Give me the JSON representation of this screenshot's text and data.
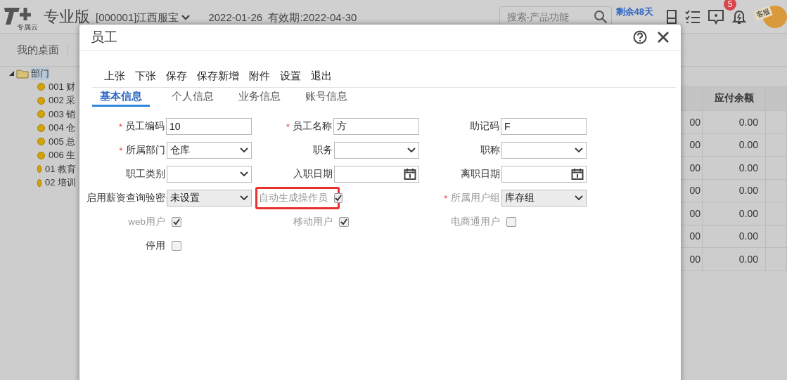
{
  "header": {
    "product": "专业版",
    "logo_sub": "专属云",
    "account": "[000001]江西服宝",
    "dates": "2022-01-26  有效期:2022-04-30",
    "search": {
      "placeholder": "搜索-产品功能"
    },
    "remaining": "剩余48天",
    "badge": "5",
    "support": "客服"
  },
  "nav": {
    "tabs": [
      {
        "label": "我的桌面",
        "selected": false
      }
    ]
  },
  "tree": {
    "label": "部门",
    "expanded": true,
    "selected": true,
    "children": [
      {
        "label": "001 财",
        "selected": false
      },
      {
        "label": "002 采",
        "selected": false
      },
      {
        "label": "003 销",
        "selected": false
      },
      {
        "label": "004 仓",
        "selected": false
      },
      {
        "label": "005 总",
        "selected": false
      },
      {
        "label": "006 生",
        "selected": false
      },
      {
        "label": "01 教育",
        "selected": false
      },
      {
        "label": "02 培训",
        "selected": false
      }
    ]
  },
  "table": {
    "columns": [
      "",
      "应付余额",
      ""
    ],
    "rows": [
      [
        "00",
        "0.00",
        ""
      ],
      [
        "00",
        "0.00",
        ""
      ],
      [
        "00",
        "0.00",
        ""
      ],
      [
        "00",
        "0.00",
        ""
      ],
      [
        "00",
        "0.00",
        ""
      ],
      [
        "00",
        "0.00",
        ""
      ],
      [
        "00",
        "0.00",
        ""
      ]
    ]
  },
  "dialog": {
    "title": "员工",
    "toolbar": [
      "上张",
      "下张",
      "保存",
      "保存新增",
      "附件",
      "设置",
      "退出"
    ],
    "tabs": [
      {
        "label": "基本信息",
        "selected": true
      },
      {
        "label": "个人信息",
        "selected": false
      },
      {
        "label": "业务信息",
        "selected": false
      },
      {
        "label": "账号信息",
        "selected": false
      }
    ],
    "rows": [
      [
        {
          "label": "员工编码",
          "kind": "text",
          "required_mark": "*",
          "value": "10"
        },
        {
          "label": "员工名称",
          "kind": "text",
          "required_mark": "*",
          "value": "方"
        },
        {
          "label": "助记码",
          "kind": "text",
          "value": "F"
        }
      ],
      [
        {
          "label": "所属部门",
          "kind": "select",
          "required_mark": "*",
          "value": "仓库"
        },
        {
          "label": "职务",
          "kind": "select"
        },
        {
          "label": "职称",
          "kind": "select"
        }
      ],
      [
        {
          "label": "职工类别",
          "kind": "select"
        },
        {
          "label": "入职日期",
          "kind": "date"
        },
        {
          "label": "离职日期",
          "kind": "date"
        }
      ],
      [
        {
          "label": "启用薪资查询验密",
          "kind": "select",
          "disabled": true,
          "value": "未设置"
        },
        {
          "label": "自动生成操作员",
          "kind": "checkbox",
          "label_dimmed": true,
          "checked": true,
          "highlighted": true
        },
        {
          "label": "所属用户组",
          "kind": "select",
          "required_mark": "*",
          "label_dimmed": true,
          "disabled": true,
          "value": "库存组"
        }
      ],
      [
        {
          "label": "web用户",
          "kind": "checkbox",
          "label_dimmed": true,
          "checked": true
        },
        {
          "label": "移动用户",
          "kind": "checkbox",
          "label_dimmed": true,
          "checked": true
        },
        {
          "label": "电商通用户",
          "kind": "checkbox",
          "label_dimmed": true,
          "checked": false
        }
      ],
      [
        {
          "label": "停用",
          "kind": "checkbox",
          "label_dimmed": false,
          "checked": false
        }
      ]
    ]
  }
}
